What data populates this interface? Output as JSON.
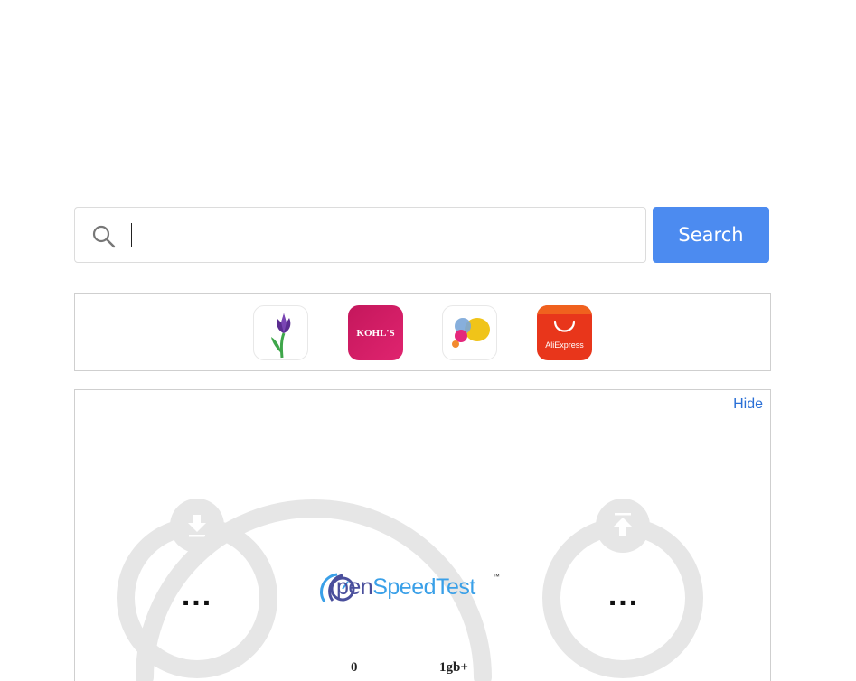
{
  "search": {
    "placeholder": "",
    "value": "",
    "button_label": "Search"
  },
  "shortcuts": [
    {
      "name": "Tulip",
      "icon": "tulip-icon"
    },
    {
      "name": "KOHL'S",
      "icon": "kohls-icon"
    },
    {
      "name": "Chat bubbles",
      "icon": "bubbles-icon"
    },
    {
      "name": "AliExpress",
      "icon": "aliexpress-icon"
    }
  ],
  "speedtest": {
    "hide_label": "Hide",
    "download_value": "...",
    "upload_value": "...",
    "scale_min": "0",
    "scale_max": "1gb+",
    "brand_text_a": "pen",
    "brand_text_b": "SpeedTest",
    "brand_tm": "™"
  },
  "colors": {
    "search_button": "#4c8bf0",
    "link": "#2a6fd6",
    "gauge_track": "#e6e6e6"
  }
}
